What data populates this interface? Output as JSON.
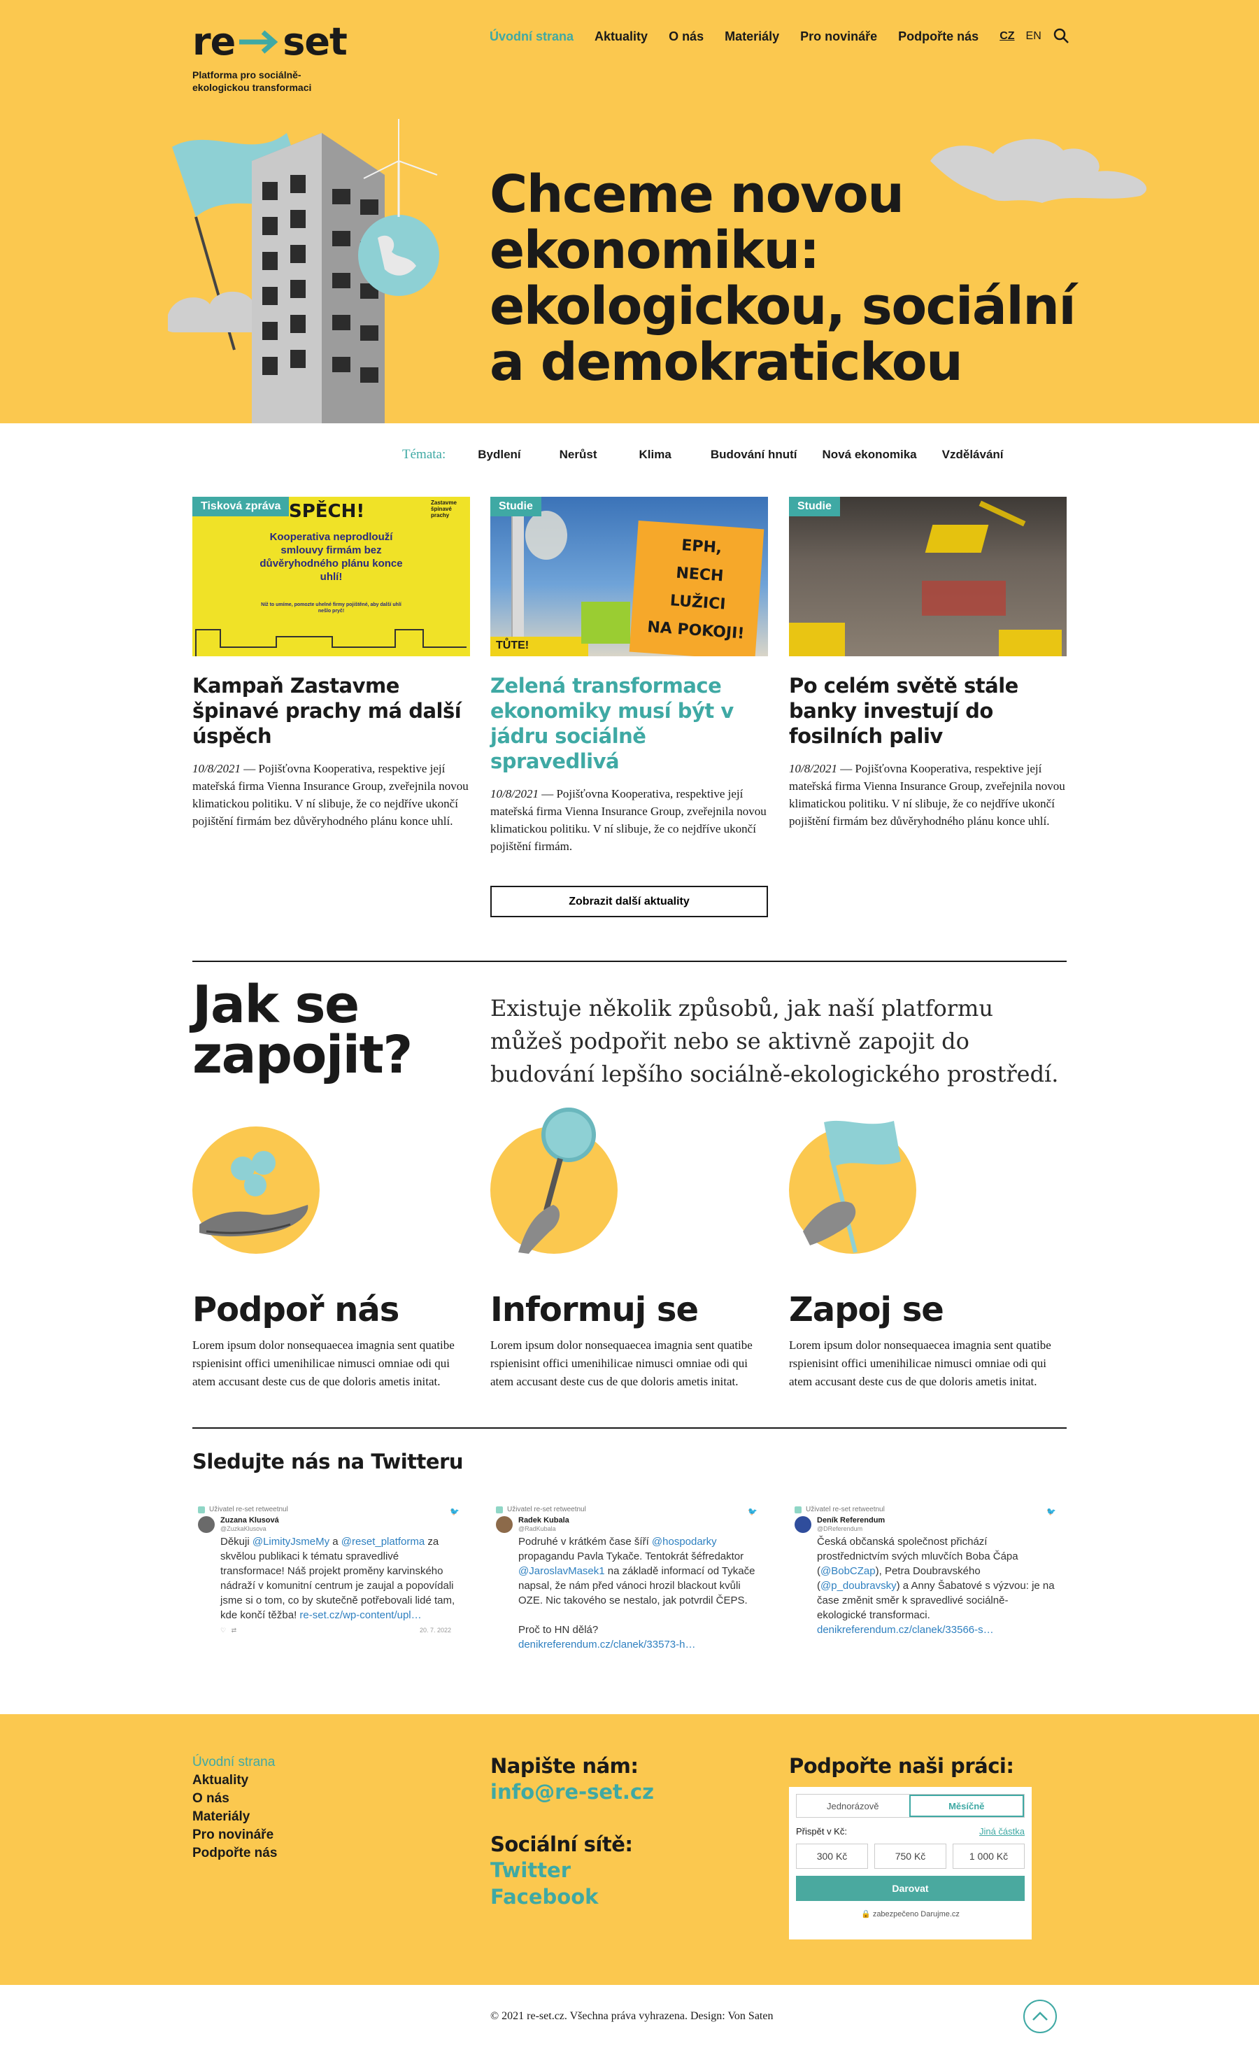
{
  "header": {
    "logo_text": "re→set",
    "tagline": "Platforma pro sociálně-ekologickou transformaci",
    "nav": [
      {
        "label": "Úvodní strana",
        "active": true
      },
      {
        "label": "Aktuality"
      },
      {
        "label": "O nás"
      },
      {
        "label": "Materiály"
      },
      {
        "label": "Pro novináře"
      },
      {
        "label": "Podpořte nás"
      }
    ],
    "lang": {
      "cz": "CZ",
      "en": "EN"
    },
    "search_icon": "search-icon"
  },
  "hero": {
    "title": "Chceme novou ekonomiku: ekologickou, sociální a demokratickou"
  },
  "topics": {
    "label": "Témata:",
    "items": [
      "Bydlení",
      "Nerůst",
      "Klima",
      "Budování hnutí",
      "Nová ekonomika",
      "Vzdělávání"
    ]
  },
  "articles": [
    {
      "badge": "Tisková zpráva",
      "image_text": {
        "headline": "SPĚCH!",
        "body": "Kooperativa neprodlouží smlouvy firmám bez důvěryhodného plánu konce uhlí!",
        "small": "Níž to umíme, pomozte uhelné firmy pojištěné, aby další uhlí nešlo pryč!",
        "corner": "Zastavme špinavé prachy"
      },
      "title": "Kampaň Zastavme špinavé prachy má další úspěch",
      "date": "10/8/2021",
      "text": "Pojišťovna Kooperativa, respektive její mateřská firma Vienna Insurance Group, zveřejnila novou klimatickou politiku. V ní slibuje, že co nejdříve ukončí pojištění firmám bez důvěryhodného plánu konce uhlí."
    },
    {
      "badge": "Studie",
      "image_text": {
        "sign_lines": [
          "EPH,",
          "NECH",
          "LUŽICI",
          "NA POKOJI!"
        ],
        "banner": "TŮTE!"
      },
      "title": "Zelená transformace ekonomiky musí být v jádru sociálně spravedlivá",
      "date": "10/8/2021",
      "text": "Pojišťovna Kooperativa, respektive její mateřská firma Vienna Insurance Group, zveřejnila novou klimatickou politiku. V ní slibuje, že co nejdříve ukončí pojištění firmám."
    },
    {
      "badge": "Studie",
      "title": "Po celém světě stále banky investují do fosilních paliv",
      "date": "10/8/2021",
      "text": "Pojišťovna Kooperativa, respektive její mateřská firma Vienna Insurance Group, zveřejnila novou klimatickou politiku. V ní slibuje, že co nejdříve ukončí pojištění firmám bez důvěryhodného plánu konce uhlí."
    }
  ],
  "more_button": "Zobrazit další aktuality",
  "join": {
    "title": "Jak se zapojit?",
    "intro": "Existuje několik způsobů, jak naší platformu můžeš podpořit nebo se aktivně zapojit do budování lepšího sociálně-ekologického prostředí.",
    "ways": [
      {
        "title": "Podpoř nás",
        "text": "Lorem ipsum dolor nonsequaecea imagnia sent quatibe rspienisint offici umenihilicae nimusci omniae odi qui atem accusant deste cus de que doloris ametis initat.",
        "icon": "hand-coins-icon"
      },
      {
        "title": "Informuj se",
        "text": "Lorem ipsum dolor nonsequaecea imagnia sent quatibe rspienisint offici umenihilicae nimusci omniae odi qui atem accusant deste cus de que doloris ametis initat.",
        "icon": "magnifier-icon"
      },
      {
        "title": "Zapoj se",
        "text": "Lorem ipsum dolor nonsequaecea imagnia sent quatibe rspienisint offici umenihilicae nimusci omniae odi qui atem accusant deste cus de que doloris ametis initat.",
        "icon": "flag-icon"
      }
    ]
  },
  "twitter": {
    "title": "Sledujte nás na Twitteru",
    "tweets": [
      {
        "retweet": "Uživatel re-set retweetnul",
        "name": "Zuzana Klusová",
        "handle": "@ZuzkaKlusova",
        "parts": [
          {
            "t": "Děkuji "
          },
          {
            "t": "@LimityJsmeMy",
            "l": true
          },
          {
            "t": " a "
          },
          {
            "t": "@reset_platforma",
            "l": true
          },
          {
            "t": " za skvělou publikaci k tématu spravedlivé transformace! Náš projekt proměny karvinského nádraží v komunitní centrum je zaujal a popovídali jsme si o tom, co by skutečně potřebovali lidé tam, kde končí těžba! "
          },
          {
            "t": "re-set.cz/wp-content/upl…",
            "l": true
          }
        ],
        "date": "20. 7. 2022"
      },
      {
        "retweet": "Uživatel re-set retweetnul",
        "name": "Radek Kubala",
        "handle": "@RadKubala",
        "parts": [
          {
            "t": "Podruhé v krátkém čase šíří "
          },
          {
            "t": "@hospodarky",
            "l": true
          },
          {
            "t": " propagandu Pavla Tykače. Tentokrát šéfredaktor "
          },
          {
            "t": "@JaroslavMasek1",
            "l": true
          },
          {
            "t": " na základě informací od Tykače napsal, že nám před vánoci hrozil blackout kvůli OZE. Nic takového se nestalo, jak potvrdil ČEPS.\n\nProč to HN dělá? "
          },
          {
            "t": "denikreferendum.cz/clanek/33573-h…",
            "l": true
          }
        ],
        "date": ""
      },
      {
        "retweet": "Uživatel re-set retweetnul",
        "name": "Deník Referendum",
        "handle": "@DReferendum",
        "parts": [
          {
            "t": "Česká občanská společnost přichází prostřednictvím svých mluvčích Boba Čápa ("
          },
          {
            "t": "@BobCZap",
            "l": true
          },
          {
            "t": "), Petra Doubravského ("
          },
          {
            "t": "@p_doubravsky",
            "l": true
          },
          {
            "t": ") a Anny Šabatové s výzvou: je na čase změnit směr k spravedlivé sociálně-ekologické transformaci. "
          },
          {
            "t": "denikreferendum.cz/clanek/33566-s…",
            "l": true
          }
        ],
        "date": ""
      }
    ]
  },
  "footer": {
    "links": [
      "Úvodní strana",
      "Aktuality",
      "O nás",
      "Materiály",
      "Pro novináře",
      "Podpořte nás"
    ],
    "write_title": "Napište nám:",
    "email": "info@re-set.cz",
    "social_title": "Sociální sítě:",
    "social": [
      "Twitter",
      "Facebook"
    ],
    "donate": {
      "title": "Podpořte naši práci:",
      "tab_once": "Jednorázově",
      "tab_monthly": "Měsíčně",
      "contribute_label": "Přispět v Kč:",
      "other_amount": "Jiná částka",
      "amounts": [
        "300 Kč",
        "750 Kč",
        "1 000 Kč"
      ],
      "submit": "Darovat",
      "secured": "zabezpečeno Darujme.cz"
    },
    "copyright": "© 2021 re-set.cz. Všechna práva vyhrazena. Design: Von Saten"
  },
  "colors": {
    "yellow": "#fbc84f",
    "teal": "#3fa9a4",
    "text": "#1a1a1a"
  }
}
